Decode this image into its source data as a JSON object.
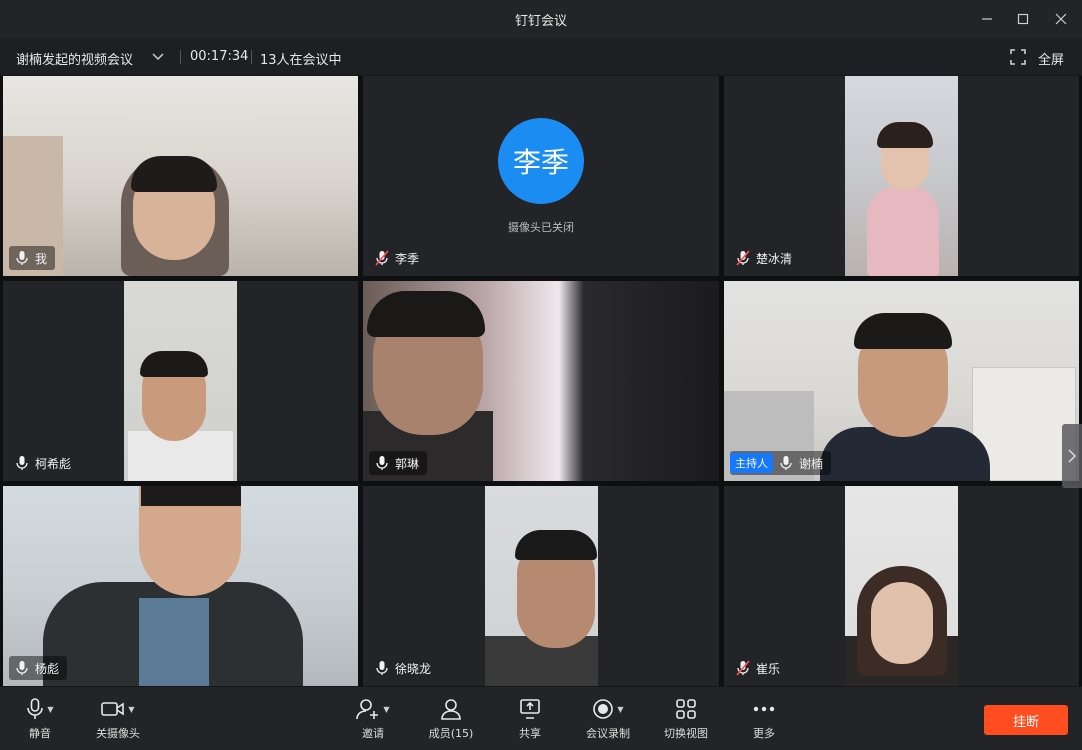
{
  "window": {
    "title": "钉钉会议"
  },
  "infobar": {
    "meeting_title": "谢楠发起的视频会议",
    "timer": "00:17:34",
    "participants_count": "13人在会议中",
    "fullscreen_label": "全屏"
  },
  "tiles": [
    {
      "name": "我",
      "mic": "on"
    },
    {
      "name": "李季",
      "mic": "muted",
      "avatar_text": "李季",
      "camera_status": "摄像头已关闭"
    },
    {
      "name": "楚冰清",
      "mic": "muted"
    },
    {
      "name": "柯希彪",
      "mic": "on"
    },
    {
      "name": "郭琳",
      "mic": "on"
    },
    {
      "name": "谢楠",
      "mic": "on",
      "badge": "主持人"
    },
    {
      "name": "杨彪",
      "mic": "on"
    },
    {
      "name": "徐晓龙",
      "mic": "on"
    },
    {
      "name": "崔乐",
      "mic": "muted"
    }
  ],
  "toolbar": {
    "mute": "静音",
    "camera_off": "关摄像头",
    "invite": "邀请",
    "members": "成员(15)",
    "share": "共享",
    "record": "会议录制",
    "switch_view": "切换视图",
    "more": "更多",
    "hangup": "挂断"
  },
  "colors": {
    "accent": "#1677ff",
    "hangup": "#ff4d1f",
    "avatar": "#1b8df2"
  }
}
